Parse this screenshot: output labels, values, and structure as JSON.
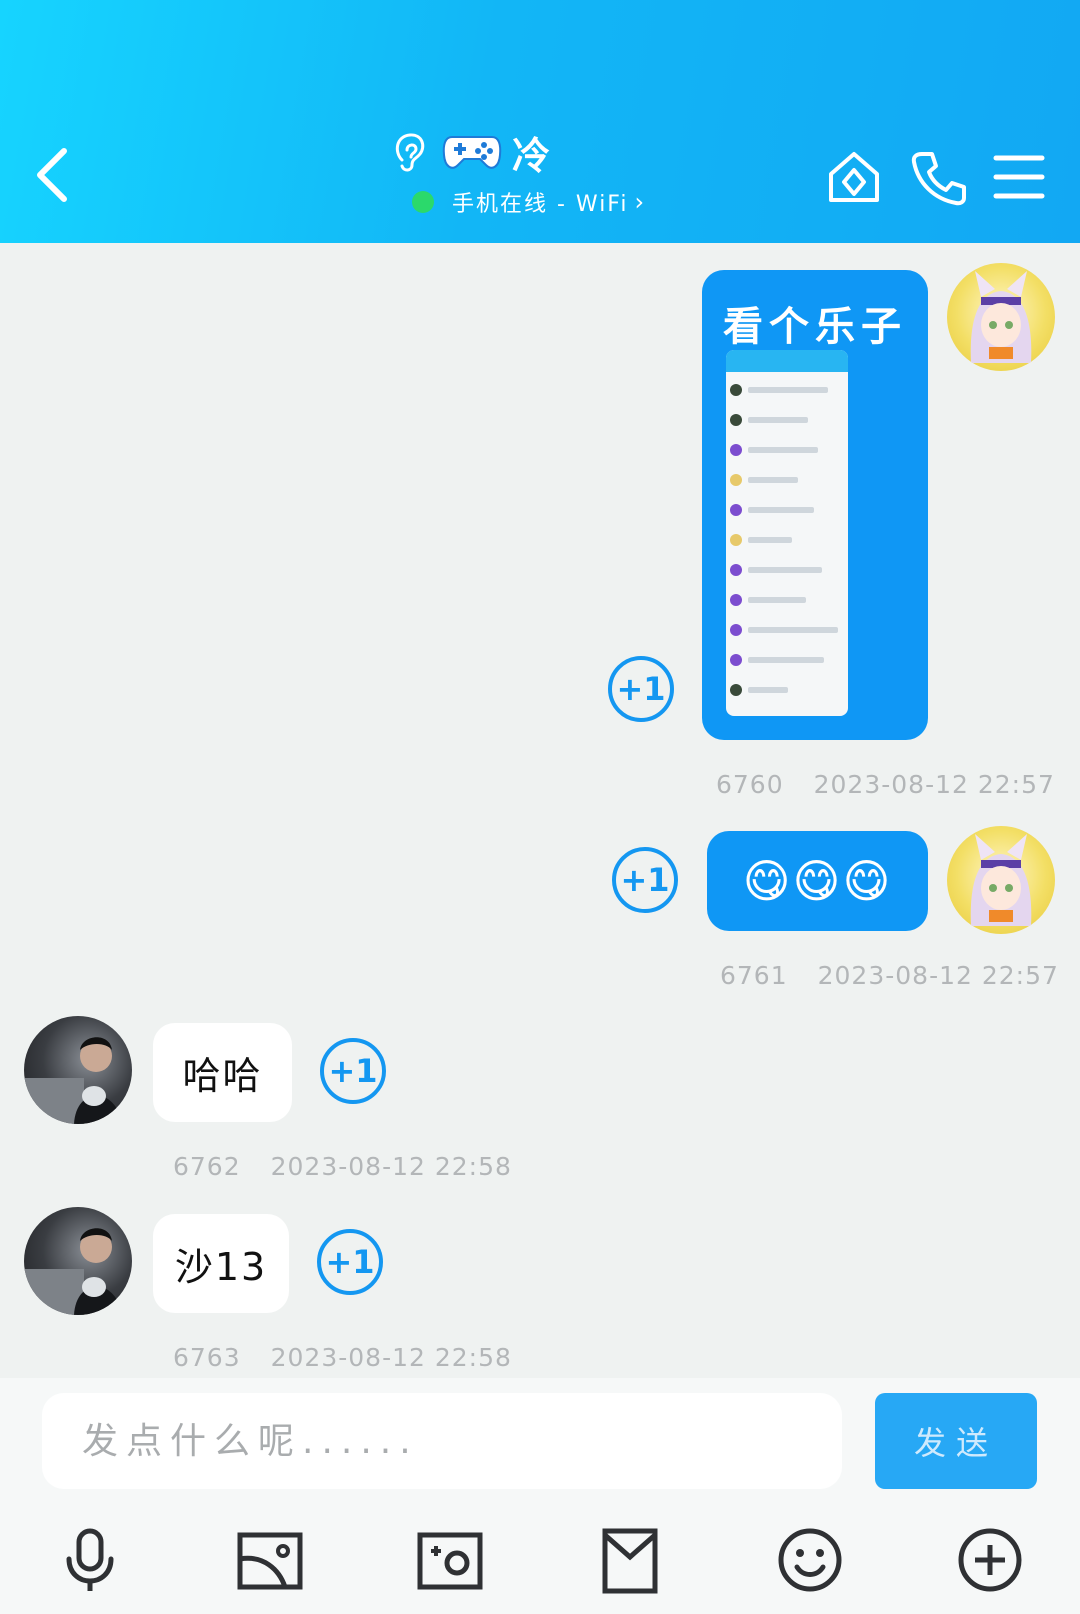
{
  "header": {
    "title": "冷",
    "status": "手机在线 - WiFi",
    "status_chevron": "›",
    "colors": {
      "gradient_start": "#16d4ff",
      "gradient_end": "#12a8f3",
      "online_dot": "#2bd96b"
    },
    "icons": [
      "back-icon",
      "ear-icon",
      "gamepad-icon",
      "home-icon",
      "phone-icon",
      "menu-icon"
    ]
  },
  "messages": [
    {
      "side": "me",
      "text": "看个乐子",
      "has_image": true,
      "image_desc": "chat-screenshot-thumbnail",
      "plus_one": "+1",
      "num": "6760",
      "time": "2023-08-12 22:57"
    },
    {
      "side": "me",
      "text": "😋😋😋",
      "plus_one": "+1",
      "num": "6761",
      "time": "2023-08-12 22:57"
    },
    {
      "side": "other",
      "text": "哈哈",
      "plus_one": "+1",
      "num": "6762",
      "time": "2023-08-12 22:58"
    },
    {
      "side": "other",
      "text": "沙13",
      "plus_one": "+1",
      "num": "6763",
      "time": "2023-08-12 22:58"
    }
  ],
  "composer": {
    "placeholder": "发点什么呢......",
    "value": "",
    "send_label": "发送",
    "tools": [
      "microphone-icon",
      "image-icon",
      "camera-icon",
      "red-packet-icon",
      "emoji-icon",
      "plus-icon"
    ]
  },
  "colors": {
    "my_bubble": "#0f97f5",
    "other_bubble": "#ffffff",
    "accent": "#1497f1",
    "send": "#27a8f5"
  }
}
